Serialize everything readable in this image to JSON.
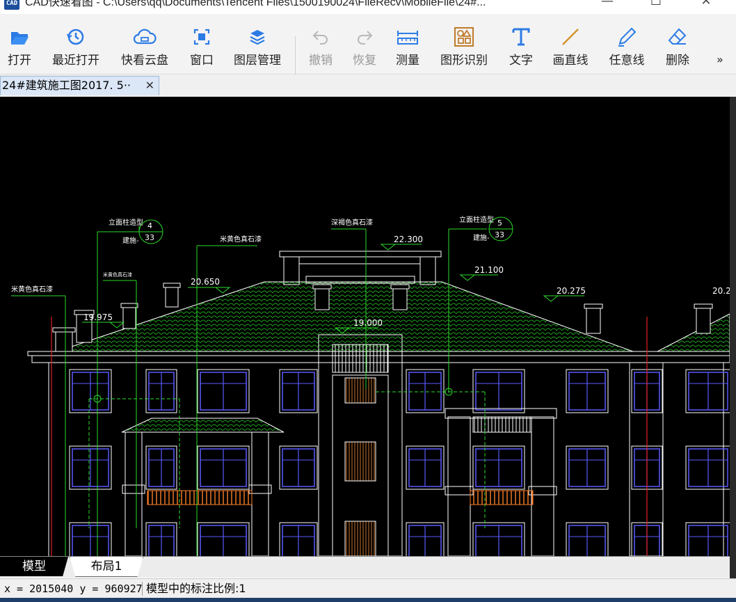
{
  "window": {
    "app_logo": "CAD",
    "title": "CAD快速看图 - C:\\Users\\qq\\Documents\\Tencent Files\\1500190024\\FileRecv\\MobileFile\\24#...",
    "minimize": "—",
    "maximize": "☐",
    "close": "✕"
  },
  "toolbar": {
    "items": [
      {
        "label": "打开",
        "icon": "folder-open-icon",
        "enabled": true
      },
      {
        "label": "最近打开",
        "icon": "history-clock-icon",
        "enabled": true
      },
      {
        "label": "快看云盘",
        "icon": "cloud-drive-icon",
        "enabled": true
      },
      {
        "label": "窗口",
        "icon": "window-icon",
        "enabled": true
      },
      {
        "label": "图层管理",
        "icon": "layers-icon",
        "enabled": true
      },
      {
        "label": "撤销",
        "icon": "undo-icon",
        "enabled": false
      },
      {
        "label": "恢复",
        "icon": "redo-icon",
        "enabled": false
      },
      {
        "label": "测量",
        "icon": "ruler-icon",
        "enabled": true
      },
      {
        "label": "图形识别",
        "icon": "shape-recognition-icon",
        "enabled": true
      },
      {
        "label": "文字",
        "icon": "text-t-icon",
        "enabled": true
      },
      {
        "label": "画直线",
        "icon": "line-icon",
        "enabled": true
      },
      {
        "label": "任意线",
        "icon": "pen-icon",
        "enabled": true
      },
      {
        "label": "删除",
        "icon": "eraser-icon",
        "enabled": true
      }
    ],
    "more": "»"
  },
  "document_tab": {
    "label": "24#建筑施工图2017. 5··",
    "close": "✕"
  },
  "drawing": {
    "annotations": {
      "note_left_top": "立面柱造型",
      "note_left_sub": "建施-",
      "callout_left_num": "4",
      "callout_left_den": "33",
      "note_mid_top": "米黄色真石漆",
      "note_center_top": "深褐色真石漆",
      "note_right_top": "立面柱造型",
      "note_right_sub": "建施-",
      "callout_right_num": "5",
      "callout_right_den": "33",
      "note_far_left": "米黄色真石漆",
      "note_small_left": "米黄色真石漆"
    },
    "elevations": {
      "e1": "22.300",
      "e2": "21.100",
      "e3": "20.650",
      "e4": "20.275",
      "e5": "19.975",
      "e6": "19.000",
      "e7": "20.2"
    }
  },
  "layout_tabs": [
    "模型",
    "布局1"
  ],
  "status": {
    "coords": "x = 2015040 y = 960927",
    "scale_note": "模型中的标注比例:1"
  },
  "colors": {
    "canvas_bg": "#000000",
    "roof_green": "#1fa31f",
    "leader_green": "#2bdc2b",
    "window_blue": "#5a5aff",
    "rail_orange": "#ff7f27",
    "axis_red": "#e02020",
    "line_white": "#ffffff"
  }
}
